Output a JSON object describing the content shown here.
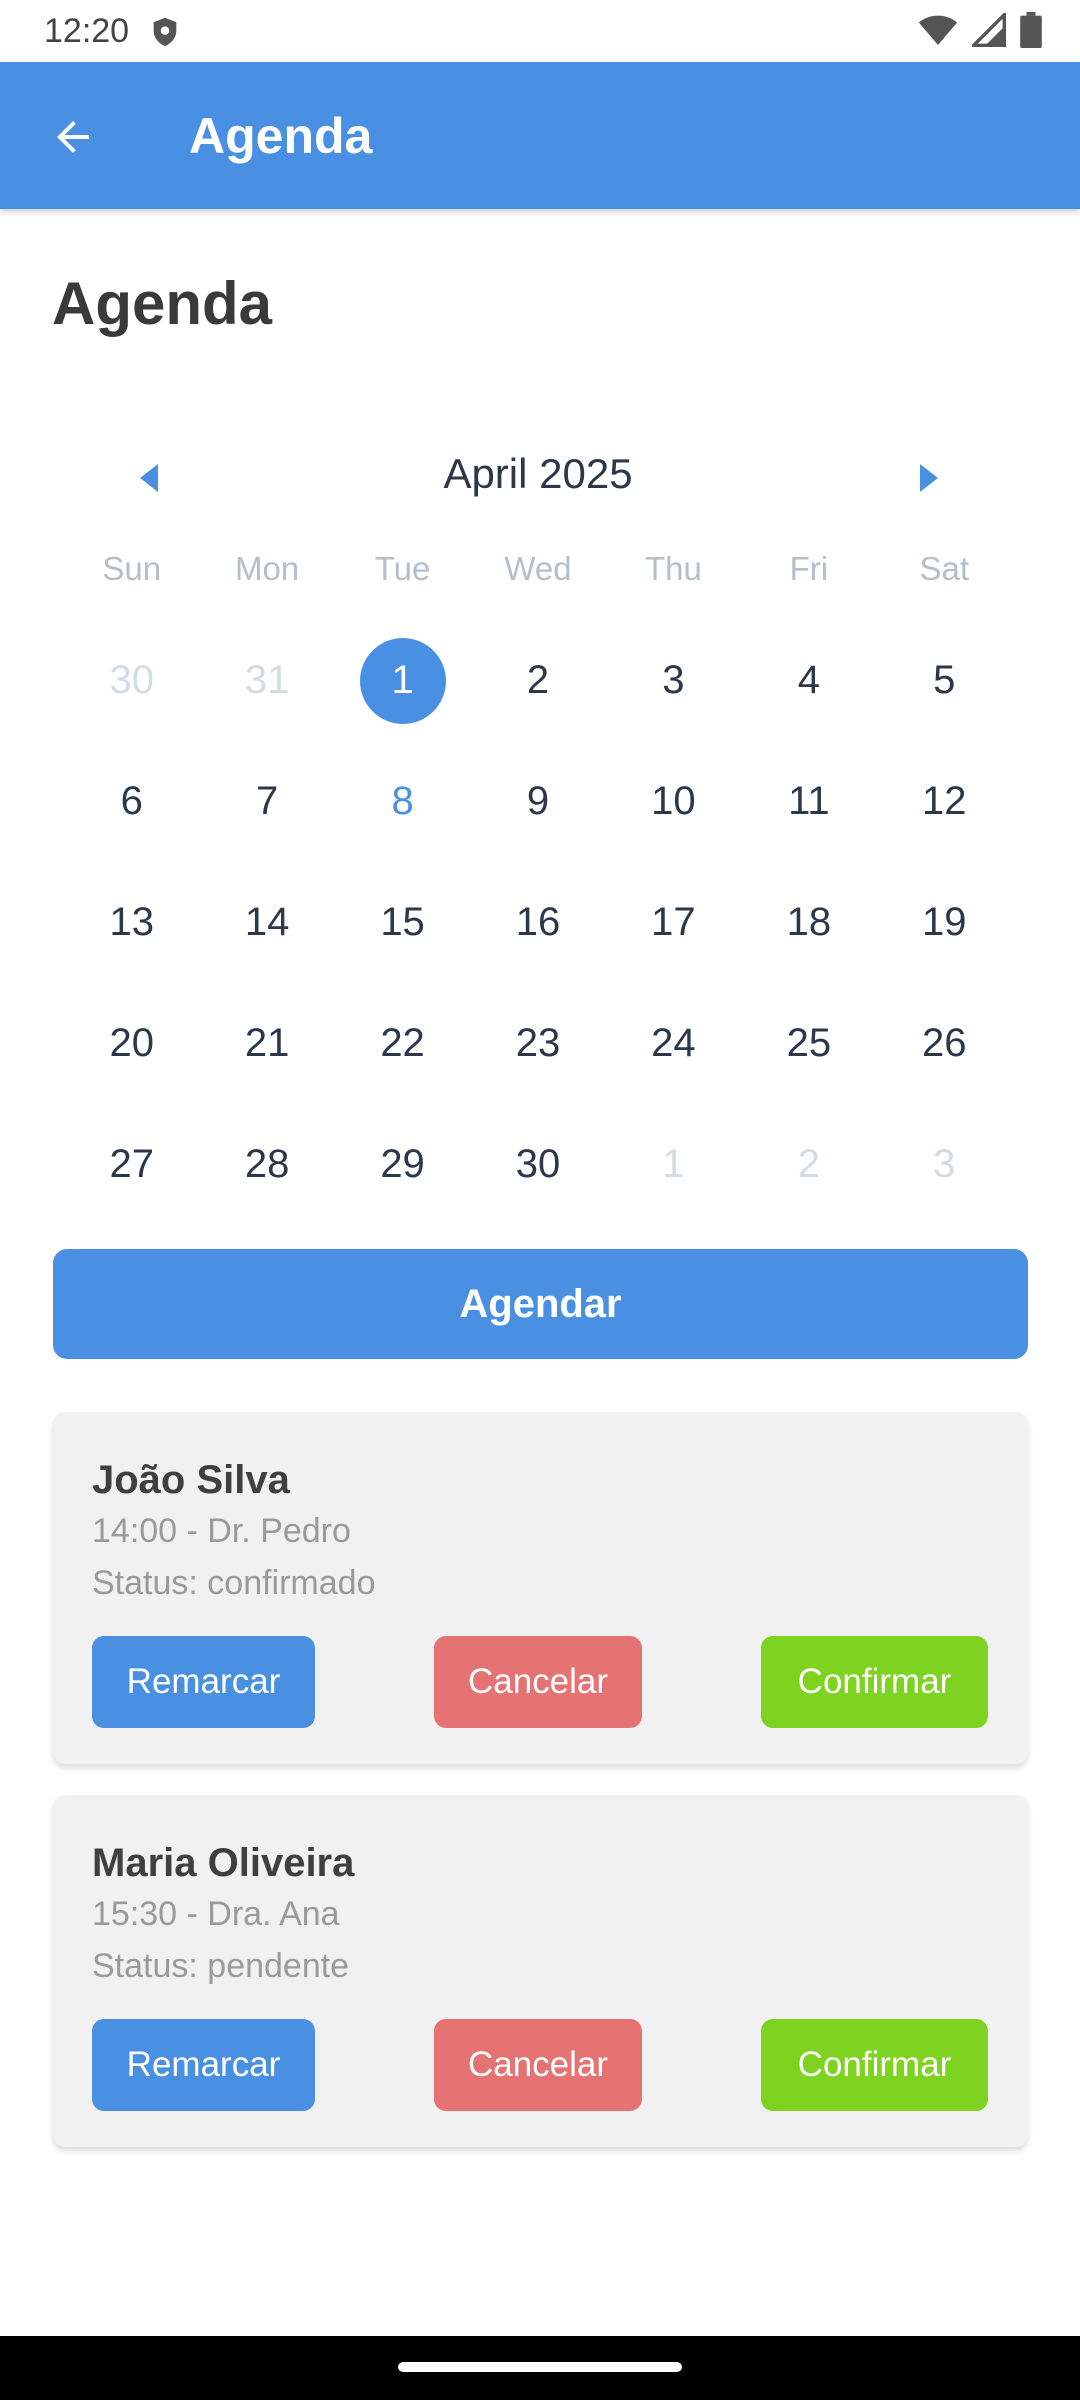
{
  "status_bar": {
    "time": "12:20"
  },
  "app_bar": {
    "title": "Agenda",
    "color": "#4a90e2"
  },
  "page": {
    "heading": "Agenda"
  },
  "calendar": {
    "month_label": "April 2025",
    "weekdays": [
      "Sun",
      "Mon",
      "Tue",
      "Wed",
      "Thu",
      "Fri",
      "Sat"
    ],
    "selected_day": "1",
    "today": "8",
    "days": [
      {
        "label": "30",
        "muted": true
      },
      {
        "label": "31",
        "muted": true
      },
      {
        "label": "1",
        "selected": true
      },
      {
        "label": "2"
      },
      {
        "label": "3"
      },
      {
        "label": "4"
      },
      {
        "label": "5"
      },
      {
        "label": "6"
      },
      {
        "label": "7"
      },
      {
        "label": "8",
        "today": true
      },
      {
        "label": "9"
      },
      {
        "label": "10"
      },
      {
        "label": "11"
      },
      {
        "label": "12"
      },
      {
        "label": "13"
      },
      {
        "label": "14"
      },
      {
        "label": "15"
      },
      {
        "label": "16"
      },
      {
        "label": "17"
      },
      {
        "label": "18"
      },
      {
        "label": "19"
      },
      {
        "label": "20"
      },
      {
        "label": "21"
      },
      {
        "label": "22"
      },
      {
        "label": "23"
      },
      {
        "label": "24"
      },
      {
        "label": "25"
      },
      {
        "label": "26"
      },
      {
        "label": "27"
      },
      {
        "label": "28"
      },
      {
        "label": "29"
      },
      {
        "label": "30"
      },
      {
        "label": "1",
        "muted": true
      },
      {
        "label": "2",
        "muted": true
      },
      {
        "label": "3",
        "muted": true
      }
    ]
  },
  "actions": {
    "schedule_label": "Agendar"
  },
  "appointments": [
    {
      "name": "João Silva",
      "time_doctor": "14:00 - Dr. Pedro",
      "status": "Status: confirmado",
      "reschedule_label": "Remarcar",
      "cancel_label": "Cancelar",
      "confirm_label": "Confirmar"
    },
    {
      "name": "Maria Oliveira",
      "time_doctor": "15:30 - Dra. Ana",
      "status": "Status: pendente",
      "reschedule_label": "Remarcar",
      "cancel_label": "Cancelar",
      "confirm_label": "Confirmar"
    }
  ],
  "colors": {
    "primary": "#4a90e2",
    "cancel": "#e57373",
    "confirm": "#7ed321"
  }
}
